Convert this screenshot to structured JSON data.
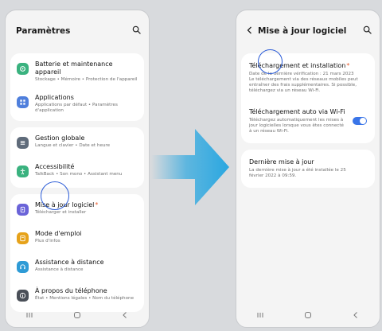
{
  "left": {
    "title": "Paramètres",
    "card1": [
      {
        "icon": "battery-icon",
        "color": "#3ab27f",
        "title": "Batterie et maintenance appareil",
        "sub": "Stockage • Mémoire • Protection de l'appareil"
      },
      {
        "icon": "apps-icon",
        "color": "#4f7fdc",
        "title": "Applications",
        "sub": "Applications par défaut • Paramètres d'application"
      }
    ],
    "card2": [
      {
        "icon": "general-icon",
        "color": "#5f6b7a",
        "title": "Gestion globale",
        "sub": "Langue et clavier • Date et heure"
      },
      {
        "icon": "accessibility-icon",
        "color": "#3ab27f",
        "title": "Accessibilité",
        "sub": "TalkBack • Son mono • Assistant menu"
      }
    ],
    "card3": [
      {
        "icon": "update-icon",
        "color": "#6a63d8",
        "title": "Mise à jour logiciel",
        "sub": "Télécharger et installer",
        "badge": "*"
      },
      {
        "icon": "manual-icon",
        "color": "#e6a21a",
        "title": "Mode d'emploi",
        "sub": "Plus d'infos"
      },
      {
        "icon": "support-icon",
        "color": "#2e9bd6",
        "title": "Assistance à distance",
        "sub": "Assistance à distance"
      },
      {
        "icon": "info-icon",
        "color": "#4a4f58",
        "title": "À propos du téléphone",
        "sub": "État • Mentions légales • Nom du téléphone"
      }
    ]
  },
  "right": {
    "title": "Mise à jour logiciel",
    "items": [
      {
        "title": "Téléchargement et installation",
        "badge": "*",
        "sub": "Date de la dernière vérification : 21 mars 2023\nLe téléchargement via des réseaux mobiles peut entraîner des frais supplémentaires. Si possible, téléchargez via un réseau Wi-Fi."
      },
      {
        "title": "Téléchargement auto via Wi-Fi",
        "sub": "Téléchargez automatiquement les mises à jour logicielles lorsque vous êtes connecté à un réseau Wi-Fi."
      }
    ],
    "item3": {
      "title": "Dernière mise à jour",
      "sub": "La dernière mise à jour a été installée le 25 février 2022 à 09:59."
    }
  },
  "colors": {
    "accent": "#3a75e8",
    "arrow": "#2aa7e0",
    "highlight": "#2a5bd7"
  }
}
